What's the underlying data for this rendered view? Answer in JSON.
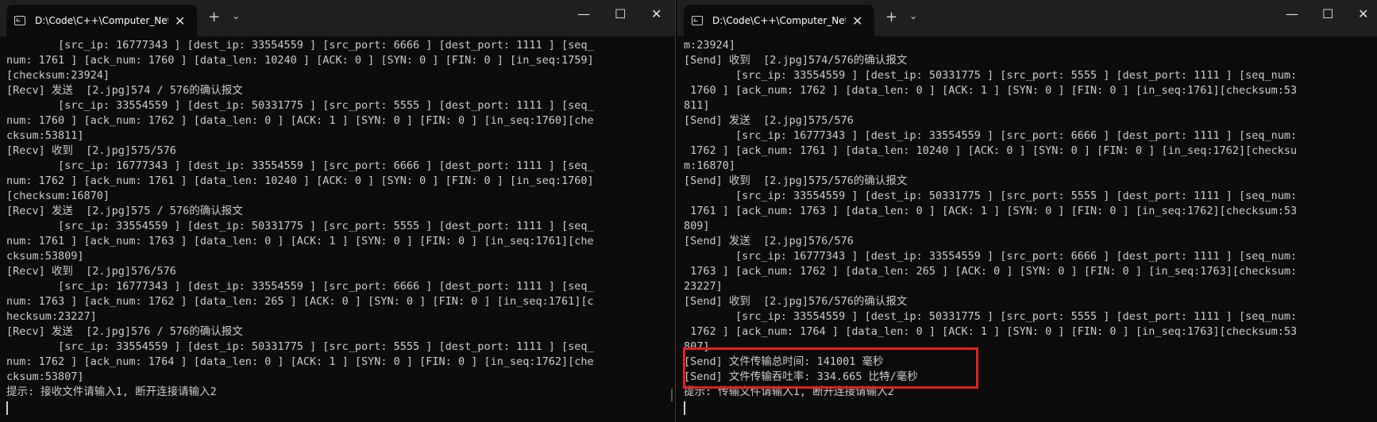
{
  "left": {
    "tab_title": "D:\\Code\\C++\\Computer_Netw",
    "close_glyph": "✕",
    "newtab_glyph": "+",
    "dropdown_glyph": "⌄",
    "controls": {
      "minimize": "—",
      "maximize": "☐",
      "close": "✕"
    },
    "lines": [
      "        [src_ip: 16777343 ] [dest_ip: 33554559 ] [src_port: 6666 ] [dest_port: 1111 ] [seq_",
      "num: 1761 ] [ack_num: 1760 ] [data_len: 10240 ] [ACK: 0 ] [SYN: 0 ] [FIN: 0 ] [in_seq:1759]",
      "[checksum:23924]",
      "[Recv] 发送  [2.jpg]574 / 576的确认报文",
      "        [src_ip: 33554559 ] [dest_ip: 50331775 ] [src_port: 5555 ] [dest_port: 1111 ] [seq_",
      "num: 1760 ] [ack_num: 1762 ] [data_len: 0 ] [ACK: 1 ] [SYN: 0 ] [FIN: 0 ] [in_seq:1760][che",
      "cksum:53811]",
      "[Recv] 收到  [2.jpg]575/576",
      "        [src_ip: 16777343 ] [dest_ip: 33554559 ] [src_port: 6666 ] [dest_port: 1111 ] [seq_",
      "num: 1762 ] [ack_num: 1761 ] [data_len: 10240 ] [ACK: 0 ] [SYN: 0 ] [FIN: 0 ] [in_seq:1760]",
      "[checksum:16870]",
      "[Recv] 发送  [2.jpg]575 / 576的确认报文",
      "        [src_ip: 33554559 ] [dest_ip: 50331775 ] [src_port: 5555 ] [dest_port: 1111 ] [seq_",
      "num: 1761 ] [ack_num: 1763 ] [data_len: 0 ] [ACK: 1 ] [SYN: 0 ] [FIN: 0 ] [in_seq:1761][che",
      "cksum:53809]",
      "[Recv] 收到  [2.jpg]576/576",
      "        [src_ip: 16777343 ] [dest_ip: 33554559 ] [src_port: 6666 ] [dest_port: 1111 ] [seq_",
      "num: 1763 ] [ack_num: 1762 ] [data_len: 265 ] [ACK: 0 ] [SYN: 0 ] [FIN: 0 ] [in_seq:1761][c",
      "hecksum:23227]",
      "[Recv] 发送  [2.jpg]576 / 576的确认报文",
      "        [src_ip: 33554559 ] [dest_ip: 50331775 ] [src_port: 5555 ] [dest_port: 1111 ] [seq_",
      "num: 1762 ] [ack_num: 1764 ] [data_len: 0 ] [ACK: 1 ] [SYN: 0 ] [FIN: 0 ] [in_seq:1762][che",
      "cksum:53807]",
      "提示: 接收文件请输入1, 断开连接请输入2"
    ]
  },
  "right": {
    "tab_title": "D:\\Code\\C++\\Computer_Netw",
    "close_glyph": "✕",
    "newtab_glyph": "+",
    "dropdown_glyph": "⌄",
    "controls": {
      "minimize": "—",
      "maximize": "☐",
      "close": "✕"
    },
    "lines": [
      "m:23924]",
      "[Send] 收到  [2.jpg]574/576的确认报文",
      "        [src_ip: 33554559 ] [dest_ip: 50331775 ] [src_port: 5555 ] [dest_port: 1111 ] [seq_num:",
      " 1760 ] [ack_num: 1762 ] [data_len: 0 ] [ACK: 1 ] [SYN: 0 ] [FIN: 0 ] [in_seq:1761][checksum:53",
      "811]",
      "[Send] 发送  [2.jpg]575/576",
      "        [src_ip: 16777343 ] [dest_ip: 33554559 ] [src_port: 6666 ] [dest_port: 1111 ] [seq_num:",
      " 1762 ] [ack_num: 1761 ] [data_len: 10240 ] [ACK: 0 ] [SYN: 0 ] [FIN: 0 ] [in_seq:1762][checksu",
      "m:16870]",
      "[Send] 收到  [2.jpg]575/576的确认报文",
      "        [src_ip: 33554559 ] [dest_ip: 50331775 ] [src_port: 5555 ] [dest_port: 1111 ] [seq_num:",
      " 1761 ] [ack_num: 1763 ] [data_len: 0 ] [ACK: 1 ] [SYN: 0 ] [FIN: 0 ] [in_seq:1762][checksum:53",
      "809]",
      "[Send] 发送  [2.jpg]576/576",
      "        [src_ip: 16777343 ] [dest_ip: 33554559 ] [src_port: 6666 ] [dest_port: 1111 ] [seq_num:",
      " 1763 ] [ack_num: 1762 ] [data_len: 265 ] [ACK: 0 ] [SYN: 0 ] [FIN: 0 ] [in_seq:1763][checksum:",
      "23227]",
      "[Send] 收到  [2.jpg]576/576的确认报文",
      "        [src_ip: 33554559 ] [dest_ip: 50331775 ] [src_port: 5555 ] [dest_port: 1111 ] [seq_num:",
      " 1762 ] [ack_num: 1764 ] [data_len: 0 ] [ACK: 1 ] [SYN: 0 ] [FIN: 0 ] [in_seq:1763][checksum:53",
      "807]",
      "[Send] 文件传输总时间: 141001 毫秒",
      "[Send] 文件传输吞吐率: 334.665 比特/毫秒",
      "提示: 传输文件请输入1, 断开连接请输入2"
    ]
  },
  "colors": {
    "terminal_bg": "#0c0c0c",
    "text": "#cccccc",
    "titlebar": "#1f1f1f",
    "highlight": "#e02020"
  }
}
